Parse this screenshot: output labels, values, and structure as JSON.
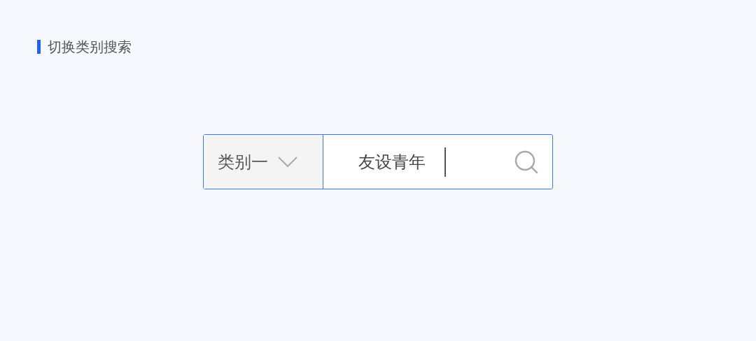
{
  "section_title": "切换类别搜索",
  "search": {
    "category": "类别一",
    "value": "友设青年",
    "focused": true
  }
}
